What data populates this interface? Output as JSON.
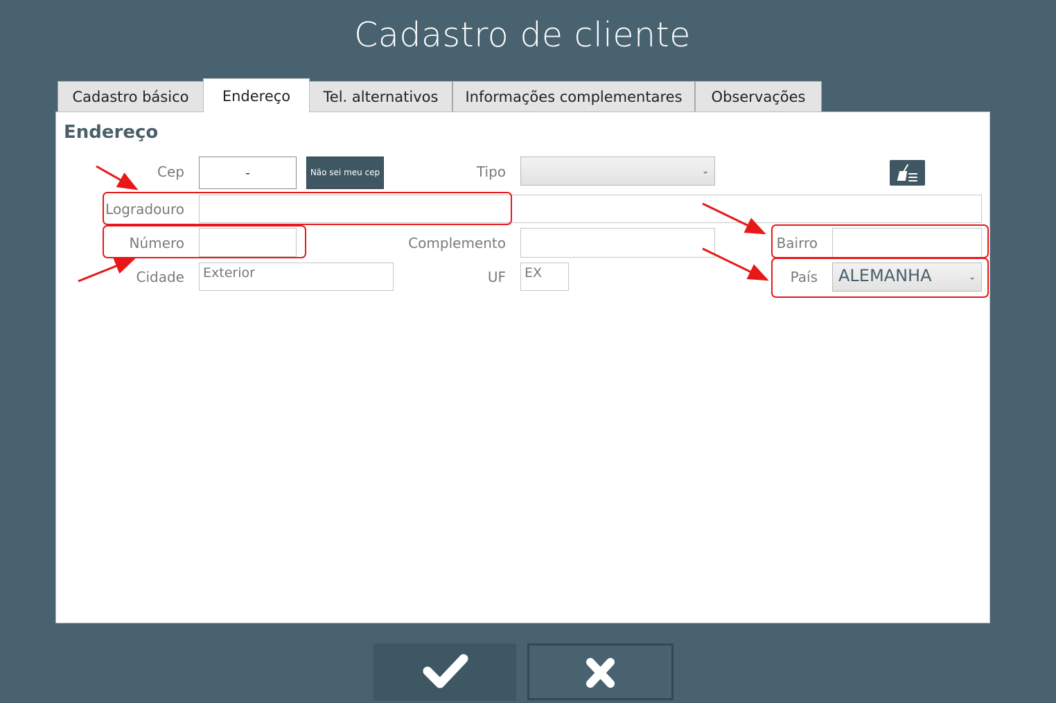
{
  "window": {
    "title": "Cadastro de cliente"
  },
  "tabs": [
    {
      "label": "Cadastro básico"
    },
    {
      "label": "Endereço",
      "active": true
    },
    {
      "label": "Tel. alternativos"
    },
    {
      "label": "Informações complementares"
    },
    {
      "label": "Observações"
    }
  ],
  "section": {
    "title": "Endereço"
  },
  "form": {
    "cep": {
      "label": "Cep",
      "value": "-"
    },
    "cep_button": "Não sei meu cep",
    "tipo": {
      "label": "Tipo",
      "value": ""
    },
    "logradouro": {
      "label": "Logradouro",
      "value": ""
    },
    "numero": {
      "label": "Número",
      "value": ""
    },
    "complemento": {
      "label": "Complemento",
      "value": ""
    },
    "bairro": {
      "label": "Bairro",
      "value": ""
    },
    "cidade": {
      "label": "Cidade",
      "value": "Exterior"
    },
    "uf": {
      "label": "UF",
      "value": "EX"
    },
    "pais": {
      "label": "País",
      "value": "ALEMANHA"
    }
  },
  "icons": {
    "clear": "broom-list-icon",
    "select": "chevron-down-icon",
    "confirm": "checkmark-icon",
    "cancel": "close-icon"
  },
  "colors": {
    "background": "#48626f",
    "accent": "#3f5763",
    "highlight": "#e81818",
    "panel": "#ffffff"
  }
}
